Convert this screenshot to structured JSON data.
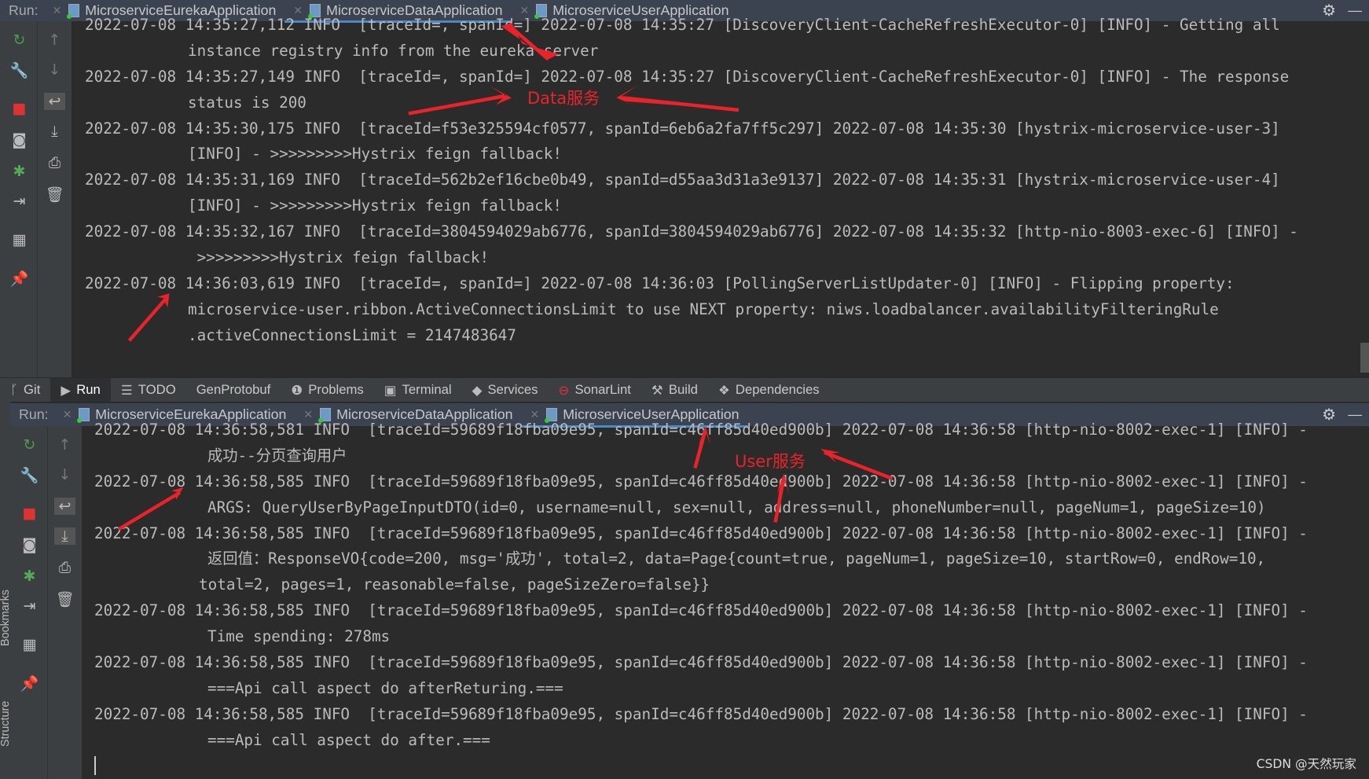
{
  "top_panel": {
    "run_label": "Run:",
    "tabs": [
      {
        "label": "MicroserviceEurekaApplication"
      },
      {
        "label": "MicroserviceDataApplication",
        "active": true
      },
      {
        "label": "MicroserviceUserApplication"
      }
    ],
    "lines": [
      {
        "text": "2022-07-08 14:35:27,112 INFO  [traceId=, spanId=] 2022-07-08 14:35:27 [DiscoveryClient-CacheRefreshExecutor-0] [INFO] - Getting all",
        "cont": false
      },
      {
        "text": "instance registry info from the eureka server",
        "cont": true
      },
      {
        "text": "2022-07-08 14:35:27,149 INFO  [traceId=, spanId=] 2022-07-08 14:35:27 [DiscoveryClient-CacheRefreshExecutor-0] [INFO] - The response",
        "cont": false
      },
      {
        "text": "status is 200",
        "cont": true
      },
      {
        "text": "2022-07-08 14:35:30,175 INFO  [traceId=f53e325594cf0577, spanId=6eb6a2fa7ff5c297] 2022-07-08 14:35:30 [hystrix-microservice-user-3]",
        "cont": false
      },
      {
        "text": "[INFO] - >>>>>>>>>Hystrix feign fallback!",
        "cont": true
      },
      {
        "text": "2022-07-08 14:35:31,169 INFO  [traceId=562b2ef16cbe0b49, spanId=d55aa3d31a3e9137] 2022-07-08 14:35:31 [hystrix-microservice-user-4]",
        "cont": false
      },
      {
        "text": "[INFO] - >>>>>>>>>Hystrix feign fallback!",
        "cont": true
      },
      {
        "text": "2022-07-08 14:35:32,167 INFO  [traceId=3804594029ab6776, spanId=3804594029ab6776] 2022-07-08 14:35:32 [http-nio-8003-exec-6] [INFO] -",
        "cont": false
      },
      {
        "text": " >>>>>>>>>Hystrix feign fallback!",
        "cont": true
      },
      {
        "text": "2022-07-08 14:36:03,619 INFO  [traceId=, spanId=] 2022-07-08 14:36:03 [PollingServerListUpdater-0] [INFO] - Flipping property:",
        "cont": false
      },
      {
        "text": "microservice-user.ribbon.ActiveConnectionsLimit to use NEXT property: niws.loadbalancer.availabilityFilteringRule",
        "cont": true
      },
      {
        "text": ".activeConnectionsLimit = 2147483647",
        "cont": true
      }
    ],
    "annotation": "Data服务"
  },
  "tool_windows": [
    {
      "label": "Git",
      "icon": "git-branch-icon"
    },
    {
      "label": "Run",
      "icon": "play-icon",
      "active": true
    },
    {
      "label": "TODO",
      "icon": "list-icon"
    },
    {
      "label": "GenProtobuf",
      "icon": ""
    },
    {
      "label": "Problems",
      "icon": "warning-icon"
    },
    {
      "label": "Terminal",
      "icon": "terminal-icon"
    },
    {
      "label": "Services",
      "icon": "services-icon"
    },
    {
      "label": "SonarLint",
      "icon": "sonarlint-icon"
    },
    {
      "label": "Build",
      "icon": "hammer-icon"
    },
    {
      "label": "Dependencies",
      "icon": "layers-icon"
    }
  ],
  "bottom_panel": {
    "run_label": "Run:",
    "tabs": [
      {
        "label": "MicroserviceEurekaApplication"
      },
      {
        "label": "MicroserviceDataApplication"
      },
      {
        "label": "MicroserviceUserApplication",
        "active": true
      }
    ],
    "lines": [
      {
        "text": "2022-07-08 14:36:58,581 INFO  [traceId=59689f18fba09e95, spanId=c46ff85d40ed900b] 2022-07-08 14:36:58 [http-nio-8002-exec-1] [INFO] -",
        "cont": false
      },
      {
        "text": "成功--分页查询用户",
        "cont": true
      },
      {
        "text": "2022-07-08 14:36:58,585 INFO  [traceId=59689f18fba09e95, spanId=c46ff85d40ed900b] 2022-07-08 14:36:58 [http-nio-8002-exec-1] [INFO] -",
        "cont": false
      },
      {
        "text": "ARGS: QueryUserByPageInputDTO(id=0, username=null, sex=null, address=null, phoneNumber=null, pageNum=1, pageSize=10)",
        "cont": true
      },
      {
        "text": "2022-07-08 14:36:58,585 INFO  [traceId=59689f18fba09e95, spanId=c46ff85d40ed900b] 2022-07-08 14:36:58 [http-nio-8002-exec-1] [INFO] -",
        "cont": false
      },
      {
        "text": "返回值：ResponseVO{code=200, msg='成功', total=2, data=Page{count=true, pageNum=1, pageSize=10, startRow=0, endRow=10,",
        "cont": true
      },
      {
        "text": "total=2, pages=1, reasonable=false, pageSizeZero=false}}",
        "cont": "short"
      },
      {
        "text": "2022-07-08 14:36:58,585 INFO  [traceId=59689f18fba09e95, spanId=c46ff85d40ed900b] 2022-07-08 14:36:58 [http-nio-8002-exec-1] [INFO] -",
        "cont": false
      },
      {
        "text": "Time spending: 278ms",
        "cont": true
      },
      {
        "text": "2022-07-08 14:36:58,585 INFO  [traceId=59689f18fba09e95, spanId=c46ff85d40ed900b] 2022-07-08 14:36:58 [http-nio-8002-exec-1] [INFO] -",
        "cont": false
      },
      {
        "text": "===Api call aspect do afterReturing.===",
        "cont": true
      },
      {
        "text": "2022-07-08 14:36:58,585 INFO  [traceId=59689f18fba09e95, spanId=c46ff85d40ed900b] 2022-07-08 14:36:58 [http-nio-8002-exec-1] [INFO] -",
        "cont": false
      },
      {
        "text": "===Api call aspect do after.===",
        "cont": true
      }
    ],
    "annotation": "User服务"
  },
  "side_strip": {
    "bookmarks": "Bookmarks",
    "structure": "Structure"
  },
  "watermark": "CSDN @天然玩家",
  "colors": {
    "annotation": "#e8232a",
    "console_bg": "#2b2b2b",
    "tab_active": "#4a88c7"
  }
}
